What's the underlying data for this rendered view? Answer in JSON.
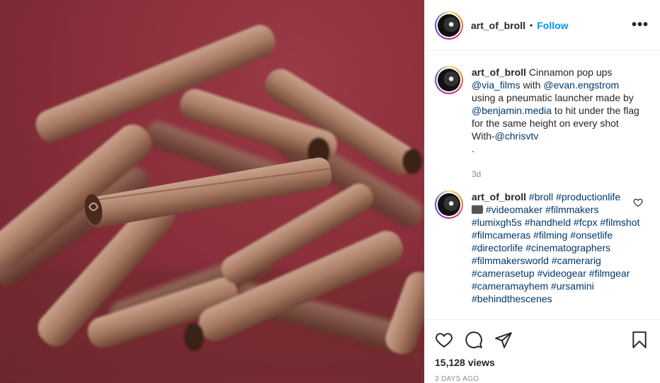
{
  "post": {
    "username": "art_of_broll",
    "dot": "•",
    "follow_label": "Follow",
    "more_label": "•••"
  },
  "caption": {
    "username": "art_of_broll",
    "text_1": " Cinnamon pop ups ",
    "mention_1": "@via_films",
    "text_2": " with ",
    "mention_2": "@evan.engstrom",
    "text_3": " using a pneumatic launcher made by ",
    "mention_3": "@benjamin.media",
    "text_4": " to hit under the flag for the same height on every shot With-",
    "mention_4": "@chrisvtv",
    "text_5": ".",
    "time": "3d"
  },
  "comment": {
    "username": "art_of_broll",
    "tags_line1": [
      "#broll",
      "#productionlife"
    ],
    "tags_rest": [
      "#videomaker",
      "#filmmakers",
      "#lumixgh5s",
      "#handheld",
      "#fcpx",
      "#filmshot",
      "#filmcameras",
      "#filming",
      "#onsetlife",
      "#directorlife",
      "#cinematographers",
      "#filmmakersworld",
      "#camerarig",
      "#camerasetup",
      "#videogear",
      "#filmgear",
      "#cameramayhem",
      "#ursamini",
      "#behindthescenes"
    ]
  },
  "stats": {
    "views": "15,128 views",
    "posted": "3 DAYS AGO"
  },
  "icons": {
    "like": "heart-icon",
    "comment": "comment-icon",
    "share": "paper-plane-icon",
    "save": "bookmark-icon",
    "more": "more-options-icon"
  },
  "colors": {
    "follow": "#0095f6",
    "mention": "#00376b",
    "background_media": "#8a2f3b"
  }
}
